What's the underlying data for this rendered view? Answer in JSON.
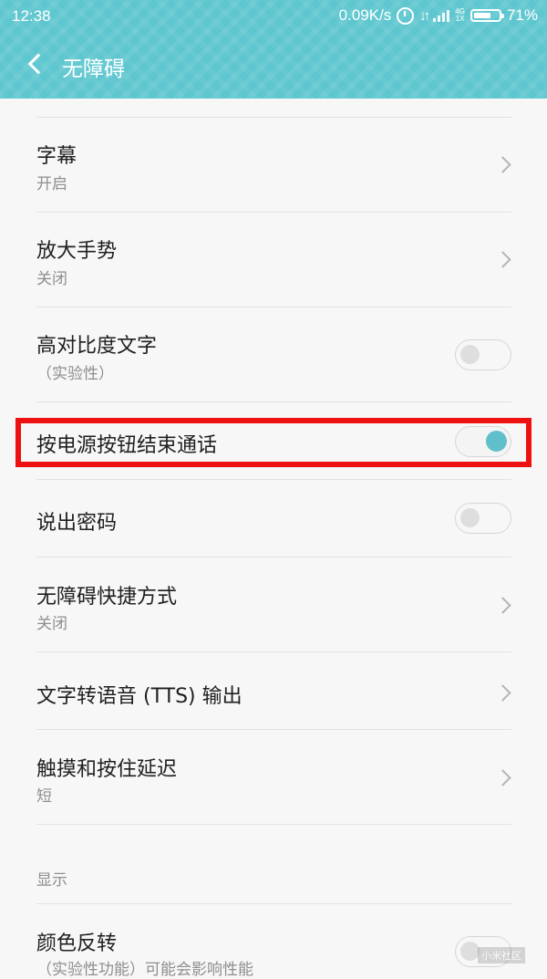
{
  "status_bar": {
    "time": "12:38",
    "speed": "0.09K/s",
    "network": "4G",
    "sim": "1X",
    "battery_pct_label": "71%",
    "battery_level": 0.71
  },
  "toolbar": {
    "title": "无障碍"
  },
  "items": {
    "captions": {
      "label": "字幕",
      "sub": "开启"
    },
    "magnify": {
      "label": "放大手势",
      "sub": "关闭"
    },
    "high_contrast": {
      "label": "高对比度文字",
      "sub": "（实验性）",
      "on": false
    },
    "power_end_call": {
      "label": "按电源按钮结束通话",
      "on": true
    },
    "speak_password": {
      "label": "说出密码",
      "on": false
    },
    "shortcut": {
      "label": "无障碍快捷方式",
      "sub": "关闭"
    },
    "tts": {
      "label": "文字转语音 (TTS) 输出"
    },
    "touch_delay": {
      "label": "触摸和按住延迟",
      "sub": "短"
    },
    "color_inversion": {
      "label": "颜色反转",
      "sub": "（实验性功能）可能会影响性能",
      "on": false
    }
  },
  "sections": {
    "display": "显示"
  },
  "colors": {
    "accent": "#5ec6cf",
    "toggle_on": "#5fbfca",
    "highlight": "#ee1111"
  },
  "watermark": "小米社区"
}
